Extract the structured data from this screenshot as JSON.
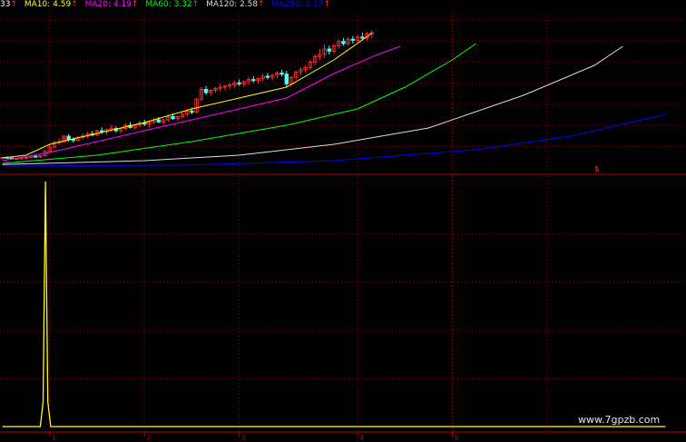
{
  "legend": {
    "ma5": {
      "label": "33",
      "arrow": "↑",
      "color": "#ffffff"
    },
    "ma10": {
      "label": "MA10: 4.59",
      "arrow": "↑",
      "color": "#ffff00"
    },
    "ma20": {
      "label": "MA20: 4.19",
      "arrow": "↑",
      "color": "#ff00ff"
    },
    "ma60": {
      "label": "MA60: 3.32",
      "arrow": "↑",
      "color": "#00ff00"
    },
    "ma120": {
      "label": "MA120: 2.58",
      "arrow": "↑",
      "color": "#dddddd"
    },
    "ma250": {
      "label": "MA250: 2.17",
      "arrow": "↑",
      "color": "#0000ff"
    },
    "arrow_color": "#ff3030"
  },
  "marker_text": "$",
  "watermark": "www.7gpzb.com",
  "colors": {
    "background": "#000000",
    "grid": "#800000",
    "axis": "#b00000",
    "up_candle": "#ff3232",
    "down_candle": "#54ffff",
    "volume": "#ffff00"
  },
  "chart_data": [
    {
      "type": "line",
      "panel": "price",
      "x_ticks": [
        "1",
        "2",
        "3",
        "4",
        "5"
      ],
      "x_tick_bars": [
        10,
        30,
        50,
        75,
        95
      ],
      "bars": 79,
      "series": [
        {
          "name": "MA10",
          "color": "#ffff00",
          "values": [
            [
              0,
              2.3
            ],
            [
              5,
              2.35
            ],
            [
              10,
              2.55
            ],
            [
              20,
              2.75
            ],
            [
              30,
              2.95
            ],
            [
              40,
              3.2
            ],
            [
              50,
              3.4
            ],
            [
              60,
              3.6
            ],
            [
              70,
              4.1
            ],
            [
              78,
              4.59
            ]
          ]
        },
        {
          "name": "MA20",
          "color": "#ff00ff",
          "values": [
            [
              0,
              2.25
            ],
            [
              10,
              2.4
            ],
            [
              20,
              2.6
            ],
            [
              30,
              2.8
            ],
            [
              40,
              3.0
            ],
            [
              50,
              3.2
            ],
            [
              60,
              3.4
            ],
            [
              70,
              3.85
            ],
            [
              79,
              4.19
            ],
            [
              84,
              4.35
            ]
          ]
        },
        {
          "name": "MA60",
          "color": "#00ff00",
          "values": [
            [
              0,
              2.2
            ],
            [
              20,
              2.35
            ],
            [
              40,
              2.6
            ],
            [
              60,
              2.9
            ],
            [
              75,
              3.2
            ],
            [
              85,
              3.6
            ],
            [
              95,
              4.1
            ],
            [
              100,
              4.4
            ]
          ]
        },
        {
          "name": "MA120",
          "color": "#dddddd",
          "values": [
            [
              0,
              2.18
            ],
            [
              30,
              2.25
            ],
            [
              50,
              2.35
            ],
            [
              70,
              2.55
            ],
            [
              90,
              2.85
            ],
            [
              110,
              3.45
            ],
            [
              125,
              4.0
            ],
            [
              131,
              4.35
            ]
          ]
        },
        {
          "name": "MA250",
          "color": "#0000ff",
          "values": [
            [
              0,
              2.15
            ],
            [
              40,
              2.17
            ],
            [
              70,
              2.25
            ],
            [
              100,
              2.45
            ],
            [
              120,
              2.7
            ],
            [
              140,
              3.1
            ]
          ]
        }
      ],
      "candles": [
        [
          2.3,
          2.32,
          2.28,
          2.31
        ],
        [
          2.31,
          2.33,
          2.29,
          2.3
        ],
        [
          2.3,
          2.31,
          2.27,
          2.28
        ],
        [
          2.28,
          2.3,
          2.26,
          2.29
        ],
        [
          2.29,
          2.32,
          2.27,
          2.3
        ],
        [
          2.3,
          2.33,
          2.28,
          2.31
        ],
        [
          2.31,
          2.34,
          2.3,
          2.33
        ],
        [
          2.33,
          2.36,
          2.31,
          2.32
        ],
        [
          2.32,
          2.35,
          2.3,
          2.34
        ],
        [
          2.34,
          2.45,
          2.32,
          2.42
        ],
        [
          2.42,
          2.55,
          2.4,
          2.5
        ],
        [
          2.5,
          2.62,
          2.48,
          2.58
        ],
        [
          2.58,
          2.66,
          2.54,
          2.6
        ],
        [
          2.6,
          2.72,
          2.58,
          2.7
        ],
        [
          2.7,
          2.74,
          2.6,
          2.64
        ],
        [
          2.64,
          2.68,
          2.58,
          2.62
        ],
        [
          2.62,
          2.7,
          2.6,
          2.68
        ],
        [
          2.68,
          2.75,
          2.64,
          2.7
        ],
        [
          2.7,
          2.78,
          2.66,
          2.74
        ],
        [
          2.74,
          2.8,
          2.7,
          2.72
        ],
        [
          2.72,
          2.82,
          2.7,
          2.8
        ],
        [
          2.8,
          2.86,
          2.74,
          2.78
        ],
        [
          2.78,
          2.84,
          2.72,
          2.82
        ],
        [
          2.82,
          2.9,
          2.78,
          2.84
        ],
        [
          2.84,
          2.88,
          2.76,
          2.8
        ],
        [
          2.8,
          2.86,
          2.76,
          2.84
        ],
        [
          2.84,
          2.94,
          2.8,
          2.9
        ],
        [
          2.9,
          2.96,
          2.84,
          2.86
        ],
        [
          2.86,
          2.92,
          2.82,
          2.9
        ],
        [
          2.9,
          2.98,
          2.86,
          2.94
        ],
        [
          2.94,
          3.0,
          2.88,
          2.92
        ],
        [
          2.92,
          2.98,
          2.86,
          2.96
        ],
        [
          2.96,
          3.04,
          2.92,
          3.0
        ],
        [
          3.0,
          3.05,
          2.94,
          2.96
        ],
        [
          2.96,
          3.02,
          2.92,
          3.0
        ],
        [
          3.0,
          3.1,
          2.96,
          3.06
        ],
        [
          3.06,
          3.12,
          3.0,
          3.02
        ],
        [
          3.02,
          3.08,
          2.98,
          3.06
        ],
        [
          3.06,
          3.14,
          3.02,
          3.1
        ],
        [
          3.1,
          3.2,
          3.06,
          3.16
        ],
        [
          3.16,
          3.22,
          3.1,
          3.14
        ],
        [
          3.14,
          3.4,
          3.12,
          3.38
        ],
        [
          3.38,
          3.6,
          3.34,
          3.56
        ],
        [
          3.56,
          3.62,
          3.46,
          3.5
        ],
        [
          3.5,
          3.56,
          3.44,
          3.54
        ],
        [
          3.54,
          3.6,
          3.5,
          3.58
        ],
        [
          3.58,
          3.66,
          3.52,
          3.6
        ],
        [
          3.6,
          3.64,
          3.54,
          3.62
        ],
        [
          3.62,
          3.68,
          3.56,
          3.64
        ],
        [
          3.64,
          3.72,
          3.58,
          3.68
        ],
        [
          3.68,
          3.74,
          3.62,
          3.66
        ],
        [
          3.66,
          3.72,
          3.6,
          3.7
        ],
        [
          3.7,
          3.78,
          3.64,
          3.74
        ],
        [
          3.74,
          3.8,
          3.68,
          3.72
        ],
        [
          3.72,
          3.78,
          3.66,
          3.76
        ],
        [
          3.76,
          3.84,
          3.7,
          3.8
        ],
        [
          3.8,
          3.86,
          3.74,
          3.78
        ],
        [
          3.78,
          3.84,
          3.72,
          3.82
        ],
        [
          3.82,
          3.9,
          3.76,
          3.86
        ],
        [
          3.86,
          3.92,
          3.8,
          3.84
        ],
        [
          3.84,
          3.9,
          3.6,
          3.66
        ],
        [
          3.66,
          3.8,
          3.62,
          3.78
        ],
        [
          3.78,
          3.9,
          3.74,
          3.88
        ],
        [
          3.88,
          3.96,
          3.82,
          3.92
        ],
        [
          3.92,
          4.0,
          3.86,
          3.96
        ],
        [
          3.96,
          4.1,
          3.92,
          4.06
        ],
        [
          4.06,
          4.2,
          4.0,
          4.16
        ],
        [
          4.16,
          4.3,
          4.1,
          4.2
        ],
        [
          4.2,
          4.38,
          4.14,
          4.3
        ],
        [
          4.3,
          4.36,
          4.2,
          4.26
        ],
        [
          4.26,
          4.4,
          4.22,
          4.36
        ],
        [
          4.36,
          4.48,
          4.3,
          4.44
        ],
        [
          4.44,
          4.5,
          4.36,
          4.4
        ],
        [
          4.4,
          4.52,
          4.36,
          4.48
        ],
        [
          4.48,
          4.54,
          4.4,
          4.46
        ],
        [
          4.46,
          4.56,
          4.42,
          4.52
        ],
        [
          4.52,
          4.6,
          4.46,
          4.5
        ],
        [
          4.5,
          4.62,
          4.46,
          4.58
        ],
        [
          4.58,
          4.64,
          4.5,
          4.6
        ]
      ],
      "ylim": [
        2.1,
        5.0
      ]
    },
    {
      "type": "bar",
      "panel": "volume",
      "x_ticks": [
        "1",
        "2",
        "3",
        "4",
        "5"
      ],
      "values": [
        [
          0,
          0
        ],
        [
          8,
          0
        ],
        [
          8.6,
          10
        ],
        [
          9.1,
          100
        ],
        [
          9.6,
          10
        ],
        [
          10.2,
          0
        ],
        [
          140,
          0
        ]
      ],
      "ylim": [
        0,
        100
      ]
    }
  ]
}
